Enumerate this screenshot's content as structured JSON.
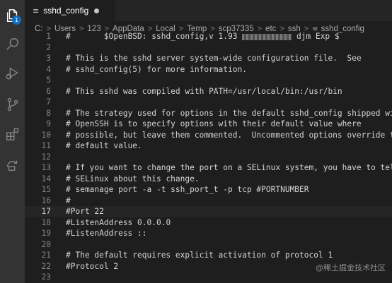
{
  "activity_bar": {
    "explorer_badge": "1",
    "items": [
      "explorer-icon",
      "search-icon",
      "run-debug-icon",
      "source-control-icon",
      "extensions-icon",
      "remote-explorer-icon"
    ]
  },
  "tab": {
    "icon": "file-lines-icon",
    "label": "sshd_config"
  },
  "breadcrumb": [
    "C:",
    "Users",
    "123",
    "AppData",
    "Local",
    "Temp",
    "scp37335",
    "etc",
    "ssh",
    "sshd_config"
  ],
  "editor": {
    "current_line": 17,
    "lines": [
      {
        "n": "1",
        "t": "#\t$OpenBSD: sshd_config,v 1.93 ",
        "tail": " djm Exp $",
        "redacted": true
      },
      {
        "n": "2",
        "t": ""
      },
      {
        "n": "3",
        "t": "# This is the sshd server system-wide configuration file.  See"
      },
      {
        "n": "4",
        "t": "# sshd_config(5) for more information."
      },
      {
        "n": "5",
        "t": ""
      },
      {
        "n": "6",
        "t": "# This sshd was compiled with PATH=/usr/local/bin:/usr/bin"
      },
      {
        "n": "7",
        "t": ""
      },
      {
        "n": "8",
        "t": "# The strategy used for options in the default sshd_config shipped with"
      },
      {
        "n": "9",
        "t": "# OpenSSH is to specify options with their default value where"
      },
      {
        "n": "10",
        "t": "# possible, but leave them commented.  Uncommented options override the"
      },
      {
        "n": "11",
        "t": "# default value."
      },
      {
        "n": "12",
        "t": ""
      },
      {
        "n": "13",
        "t": "# If you want to change the port on a SELinux system, you have to tell"
      },
      {
        "n": "14",
        "t": "# SELinux about this change."
      },
      {
        "n": "15",
        "t": "# semanage port -a -t ssh_port_t -p tcp #PORTNUMBER"
      },
      {
        "n": "16",
        "t": "#"
      },
      {
        "n": "17",
        "t": "#Port 22"
      },
      {
        "n": "18",
        "t": "#ListenAddress 0.0.0.0"
      },
      {
        "n": "19",
        "t": "#ListenAddress ::"
      },
      {
        "n": "20",
        "t": ""
      },
      {
        "n": "21",
        "t": "# The default requires explicit activation of protocol 1"
      },
      {
        "n": "22",
        "t": "#Protocol 2"
      },
      {
        "n": "23",
        "t": ""
      }
    ]
  },
  "watermark": "@稀土掘金技术社区",
  "colors": {
    "activity_bar": "#333333",
    "editor_bg": "#1e1e1e",
    "tab_bar": "#252526",
    "badge": "#0e70c0",
    "text": "#d4d4d4",
    "line_number": "#858585"
  }
}
